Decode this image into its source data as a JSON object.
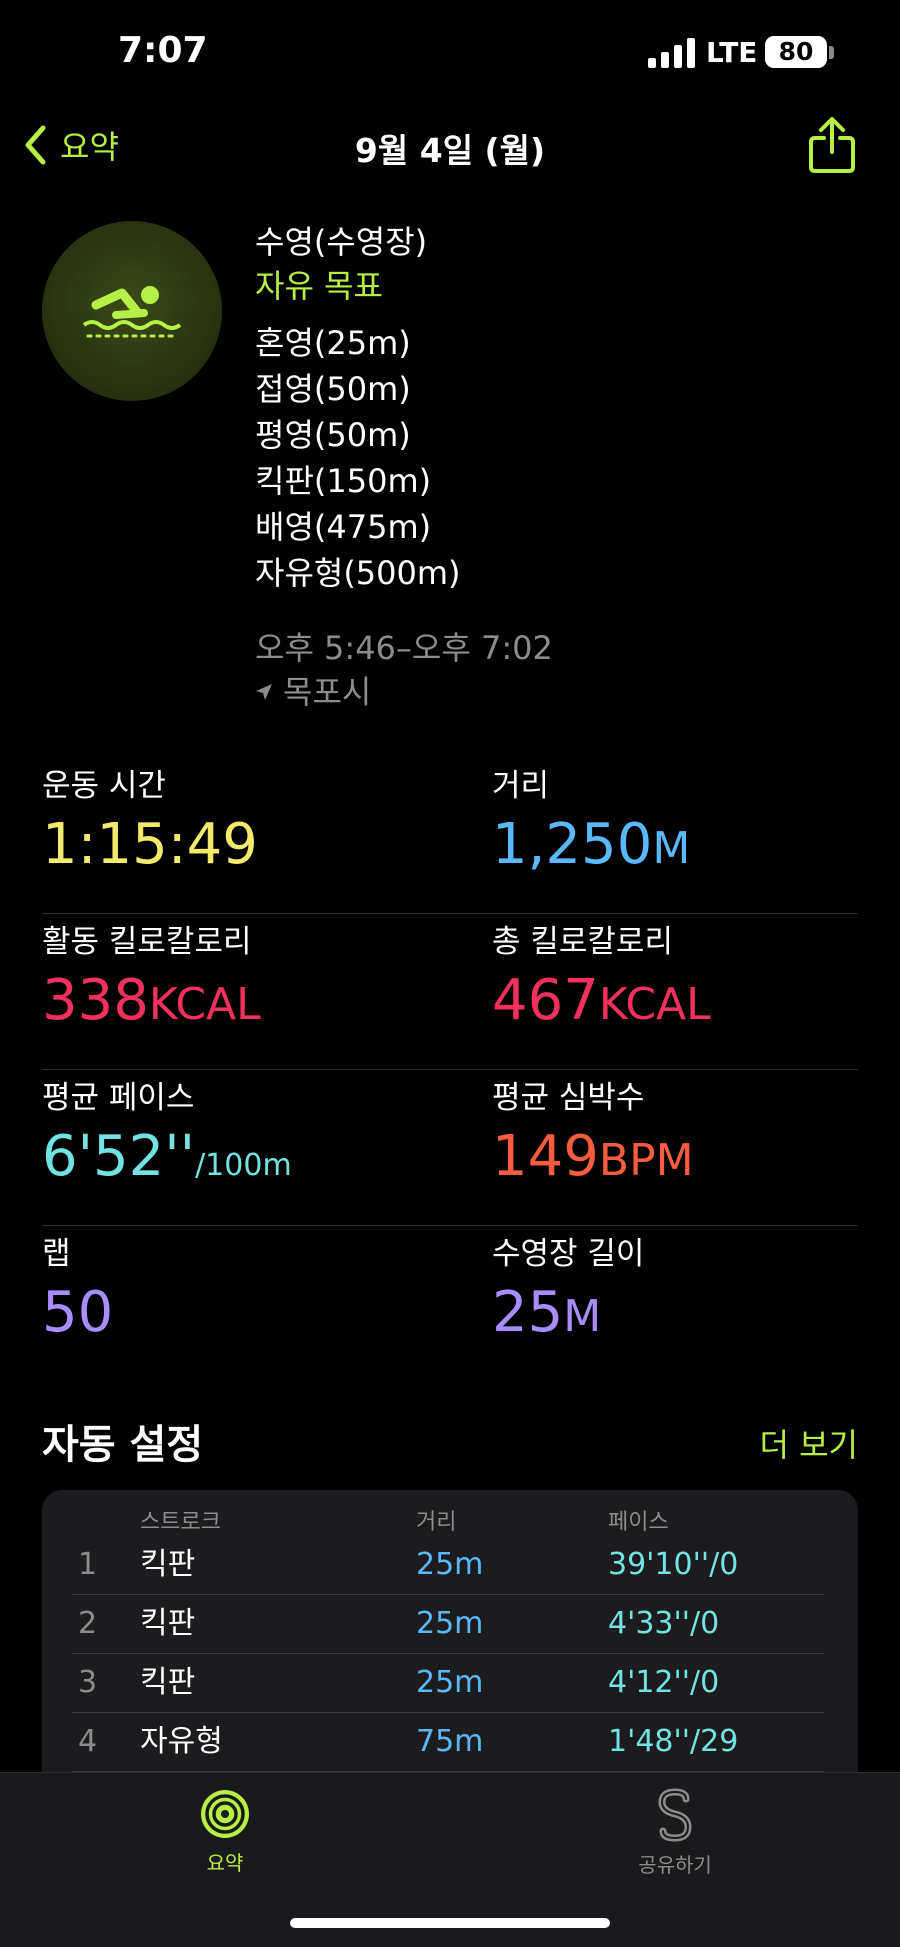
{
  "status_bar": {
    "time": "7:07",
    "network": "LTE",
    "battery": "80"
  },
  "nav": {
    "back_label": "요약",
    "title": "9월 4일 (월)"
  },
  "workout": {
    "title": "수영(수영장)",
    "goal": "자유 목표",
    "strokes": [
      "혼영(25m)",
      "접영(50m)",
      "평영(50m)",
      "킥판(150m)",
      "배영(475m)",
      "자유형(500m)"
    ],
    "time_range": "오후 5:46–오후 7:02",
    "location": "목포시"
  },
  "metrics": {
    "workout_time": {
      "label": "운동 시간",
      "value": "1:15:49"
    },
    "distance": {
      "label": "거리",
      "value": "1,250",
      "unit": "M"
    },
    "active_calories": {
      "label": "활동 킬로칼로리",
      "value": "338",
      "unit": "KCAL"
    },
    "total_calories": {
      "label": "총 킬로칼로리",
      "value": "467",
      "unit": "KCAL"
    },
    "avg_pace": {
      "label": "평균 페이스",
      "value": "6'52''",
      "unit": "/100m"
    },
    "avg_heart_rate": {
      "label": "평균 심박수",
      "value": "149",
      "unit": "BPM"
    },
    "laps": {
      "label": "랩",
      "value": "50"
    },
    "pool_length": {
      "label": "수영장 길이",
      "value": "25",
      "unit": "M"
    }
  },
  "auto_sets": {
    "title": "자동 설정",
    "more_label": "더 보기",
    "columns": {
      "stroke": "스트로크",
      "distance": "거리",
      "pace": "페이스"
    },
    "rows": [
      {
        "num": "1",
        "stroke": "킥판",
        "distance": "25m",
        "pace": "39'10''/0"
      },
      {
        "num": "2",
        "stroke": "킥판",
        "distance": "25m",
        "pace": "4'33''/0"
      },
      {
        "num": "3",
        "stroke": "킥판",
        "distance": "25m",
        "pace": "4'12''/0"
      },
      {
        "num": "4",
        "stroke": "자유형",
        "distance": "75m",
        "pace": "1'48''/29"
      }
    ]
  },
  "tab_bar": {
    "summary_label": "요약",
    "sharing_label": "공유하기"
  },
  "colors": {
    "accent_green": "#b6ef45",
    "time_yellow": "#f2ea6a",
    "distance_blue": "#5ab8ff",
    "calorie_red": "#f2305e",
    "pace_cyan": "#72e3e0",
    "heart_orange": "#f75c3f",
    "lap_purple": "#a98dff"
  }
}
